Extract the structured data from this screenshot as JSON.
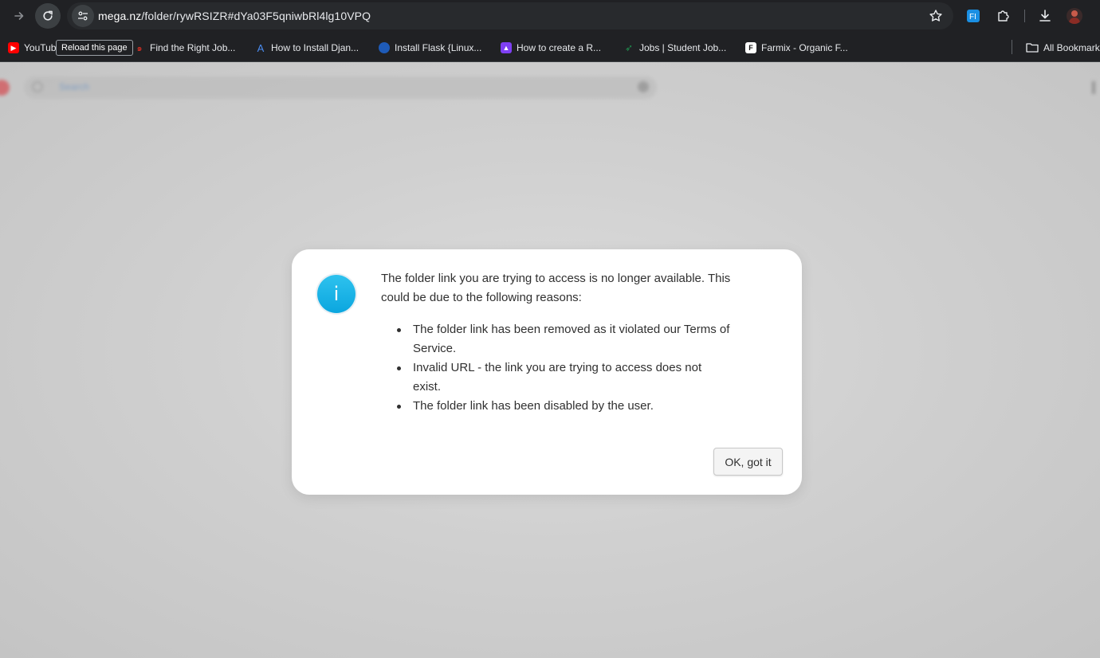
{
  "browser": {
    "url_host": "mega.nz",
    "url_rest": "/folder/rywRSIZR#dYa03F5qniwbRl4lg10VPQ",
    "tooltip": "Reload this page",
    "bookmarks": [
      {
        "label": "YouTub",
        "icon": "youtube-icon",
        "color": "#ff0000"
      },
      {
        "label": "Find the Right Job...",
        "icon": "job-site-icon",
        "color": "#d93025"
      },
      {
        "label": "How to Install Djan...",
        "icon": "tutorial-site-icon",
        "color": "#1a73e8"
      },
      {
        "label": "Install Flask {Linux...",
        "icon": "globe-icon",
        "color": "#1e5bb8"
      },
      {
        "label": "How to create a R...",
        "icon": "rocket-icon",
        "color": "#7e3ff2"
      },
      {
        "label": "Jobs | Student Job...",
        "icon": "student-jobs-icon",
        "color": "#1f8f4e"
      },
      {
        "label": "Farmix - Organic F...",
        "icon": "farmix-icon",
        "color": "#ffffff"
      }
    ],
    "all_bookmarks_label": "All Bookmarks"
  },
  "background_app": {
    "search_placeholder": "Search"
  },
  "dialog": {
    "message": "The folder link you are trying to access is no longer available. This could be due to the following reasons:",
    "reasons": [
      "The folder link has been removed as it violated our Terms of Service.",
      "Invalid URL - the link you are trying to access does not exist.",
      "The folder link has been disabled by the user."
    ],
    "ok_label": "OK, got it",
    "icon": "info-icon",
    "accent_color": "#13b3e6"
  }
}
